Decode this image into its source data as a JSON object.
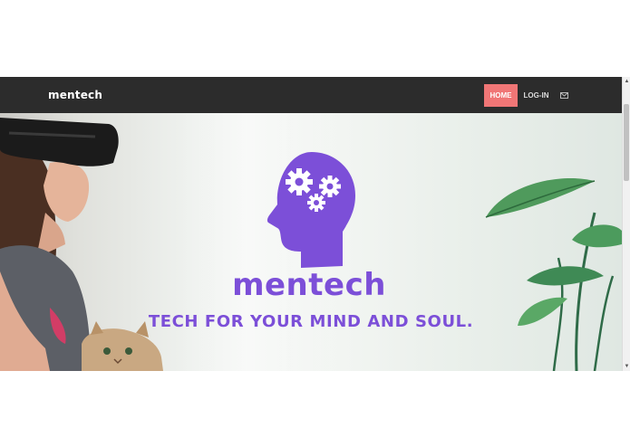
{
  "navbar": {
    "brand": "mentech",
    "items": [
      {
        "label": "HOME",
        "active": true
      },
      {
        "label": "LOG-IN",
        "active": false
      }
    ],
    "mail_icon": "envelope-icon"
  },
  "hero": {
    "title": "mentech",
    "tagline": "TECH FOR YOUR MIND AND SOUL.",
    "logo_icon": "head-with-gears-icon"
  },
  "colors": {
    "navbar_bg": "#2c2c2c",
    "active_nav": "#f07676",
    "brand_purple": "#7c4fd8"
  }
}
